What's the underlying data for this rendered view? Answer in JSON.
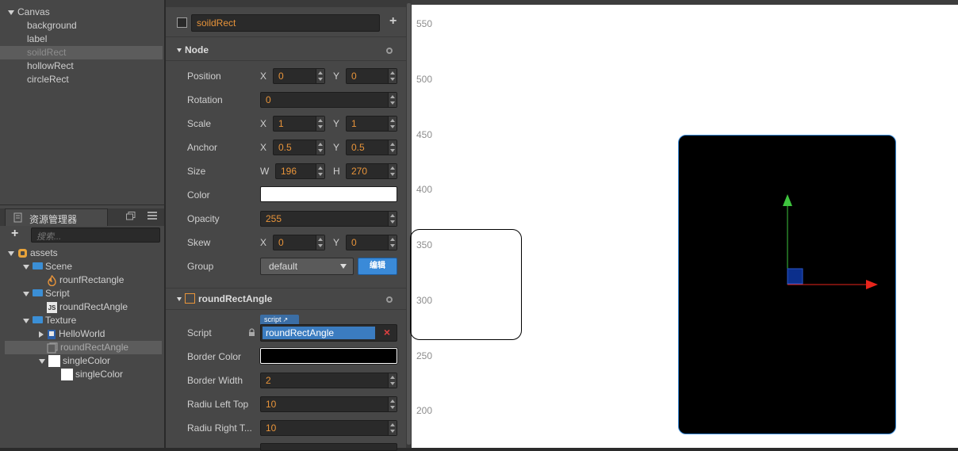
{
  "hierarchy": {
    "items": [
      {
        "label": "Canvas"
      },
      {
        "label": "background"
      },
      {
        "label": "label"
      },
      {
        "label": "soildRect"
      },
      {
        "label": "hollowRect"
      },
      {
        "label": "circleRect"
      }
    ]
  },
  "assets_panel": {
    "title": "资源管理器",
    "search_placeholder": "搜索...",
    "tree": [
      {
        "label": "assets"
      },
      {
        "label": "Scene"
      },
      {
        "label": "rounfRectangle"
      },
      {
        "label": "Script"
      },
      {
        "label": "roundRectAngle"
      },
      {
        "label": "Texture"
      },
      {
        "label": "HelloWorld"
      },
      {
        "label": "roundRectAngle"
      },
      {
        "label": "singleColor"
      },
      {
        "label": "singleColor"
      }
    ],
    "js_badge": "JS"
  },
  "inspector": {
    "node_name": "soildRect",
    "node_section": "Node",
    "position": {
      "label": "Position",
      "x": "0",
      "y": "0"
    },
    "rotation": {
      "label": "Rotation",
      "value": "0"
    },
    "scale": {
      "label": "Scale",
      "x": "1",
      "y": "1"
    },
    "anchor": {
      "label": "Anchor",
      "x": "0.5",
      "y": "0.5"
    },
    "size": {
      "label": "Size",
      "w": "196",
      "h": "270"
    },
    "color": {
      "label": "Color",
      "value": "#ffffff"
    },
    "opacity": {
      "label": "Opacity",
      "value": "255"
    },
    "skew": {
      "label": "Skew",
      "x": "0",
      "y": "0"
    },
    "group": {
      "label": "Group",
      "value": "default",
      "edit_button": "编辑"
    },
    "axis_labels": {
      "x": "X",
      "y": "Y",
      "w": "W",
      "h": "H"
    },
    "component": {
      "title": "roundRectAngle",
      "script_label": "Script",
      "script_tag": "script",
      "script_value": "roundRectAngle",
      "border_color": {
        "label": "Border Color",
        "value": "#000000"
      },
      "border_width": {
        "label": "Border Width",
        "value": "2"
      },
      "radius_left_top": {
        "label": "Radiu Left Top",
        "value": "10"
      },
      "radius_right_top": {
        "label": "Radiu Right T...",
        "value": "10"
      }
    }
  },
  "scene": {
    "ruler_ticks": [
      "550",
      "500",
      "450",
      "400",
      "350",
      "300",
      "250",
      "200"
    ],
    "colors": {
      "rect_fill": "#000000",
      "x_axis": "#e8251c",
      "y_axis": "#3ec43e",
      "anchor": "#0b2f8c"
    }
  }
}
